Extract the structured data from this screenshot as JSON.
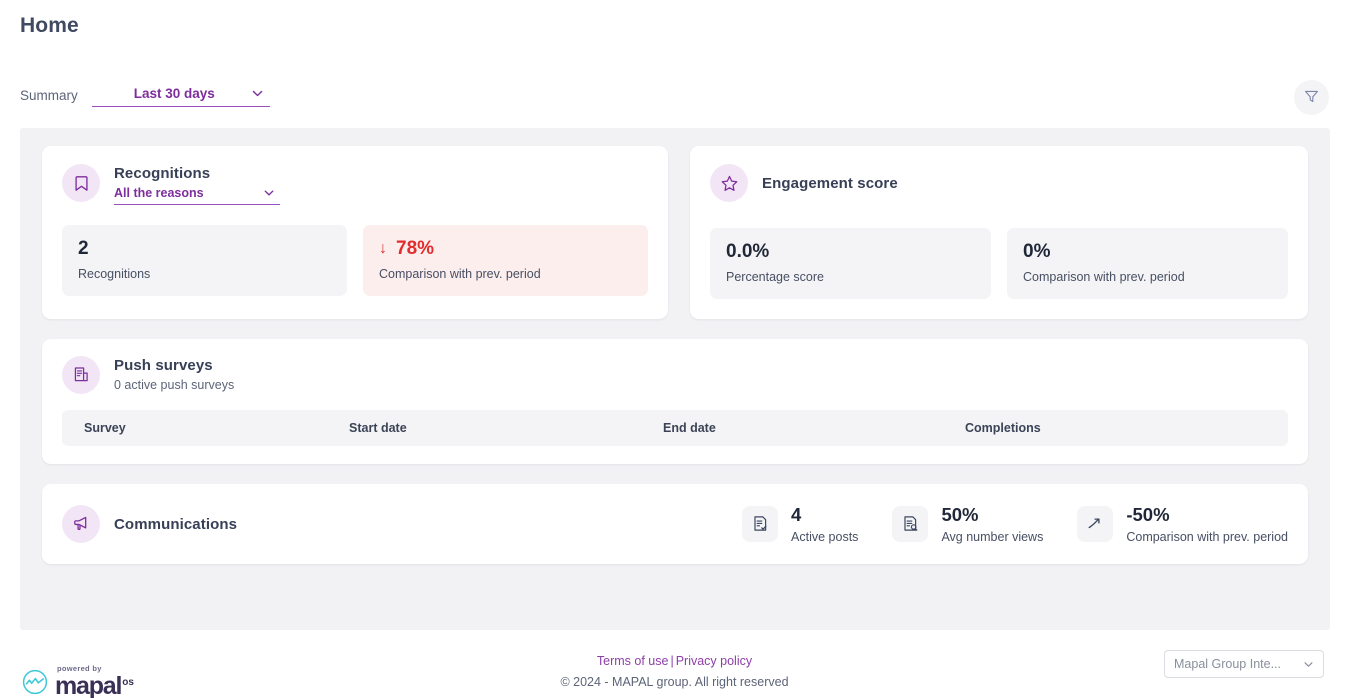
{
  "header": {
    "title": "Home",
    "summary_label": "Summary",
    "period_value": "Last 30 days",
    "filter_icon": "filter-funnel-icon"
  },
  "recognitions": {
    "icon": "bookmark-icon",
    "title": "Recognitions",
    "reason_value": "All the reasons",
    "metrics": [
      {
        "value": "2",
        "label": "Recognitions",
        "alert": false
      },
      {
        "value": "78%",
        "prefix": "↓",
        "label": "Comparison with prev. period",
        "alert": true
      }
    ]
  },
  "engagement": {
    "icon": "star-icon",
    "title": "Engagement score",
    "metrics": [
      {
        "value": "0.0%",
        "label": "Percentage score"
      },
      {
        "value": "0%",
        "label": "Comparison with prev. period"
      }
    ]
  },
  "push_surveys": {
    "icon": "document-survey-icon",
    "title": "Push surveys",
    "subtitle": "0 active push surveys",
    "columns": [
      "Survey",
      "Start date",
      "End date",
      "Completions"
    ],
    "rows": []
  },
  "communications": {
    "icon": "megaphone-icon",
    "title": "Communications",
    "metrics": [
      {
        "icon": "document-check-icon",
        "value": "4",
        "label": "Active posts"
      },
      {
        "icon": "document-search-icon",
        "value": "50%",
        "label": "Avg number views"
      },
      {
        "icon": "trend-up-icon",
        "value": "-50%",
        "label": "Comparison with prev. period"
      }
    ]
  },
  "footer": {
    "powered_by": "powered by",
    "brand_name": "mapal",
    "brand_suffix": "os",
    "terms_label": "Terms of use",
    "separator": "|",
    "privacy_label": "Privacy policy",
    "copyright": "© 2024 - MAPAL group. All right reserved",
    "group_value": "Mapal Group Inte..."
  },
  "colors": {
    "accent_purple": "#7d2d9c",
    "link_purple": "#8d3fa8",
    "alert_red": "#e12d2d",
    "icon_bg": "#f2e6f6",
    "page_bg": "#f2f2f4"
  }
}
